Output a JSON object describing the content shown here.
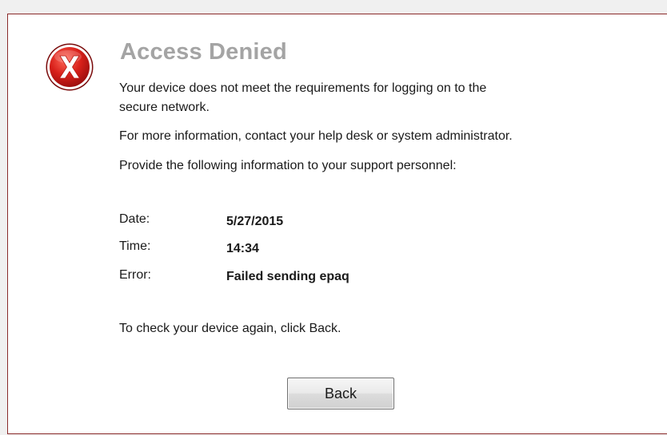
{
  "dialog": {
    "icon": "error-x-icon",
    "title": "Access Denied",
    "message_line1": "Your device does not meet the requirements for logging on to the",
    "message_line2": "secure network.",
    "more_info": "For more information, contact your help desk or system administrator.",
    "provide_info": "Provide the following information to your support personnel:"
  },
  "details": {
    "date_label": "Date:",
    "date_value": "5/27/2015",
    "time_label": "Time:",
    "time_value": "14:34",
    "error_label": "Error:",
    "error_value": "Failed sending epaq"
  },
  "footer": {
    "recheck_text": "To check your device again, click Back.",
    "back_label": "Back"
  },
  "colors": {
    "panel_border": "#8a2a2a",
    "title": "#a4a4a4",
    "icon_red": "#d11a1a"
  }
}
